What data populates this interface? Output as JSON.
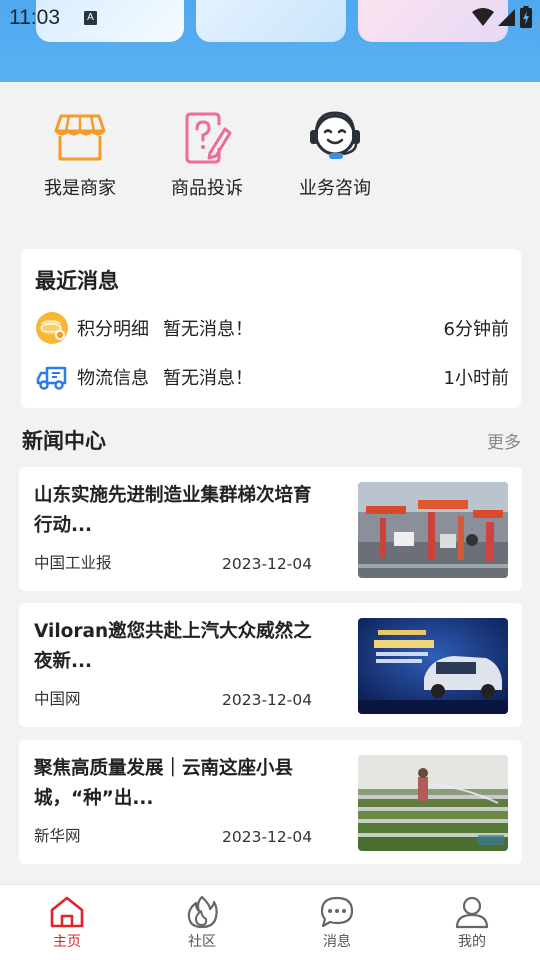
{
  "status_bar": {
    "time": "11:03",
    "notif_icon_letter": "A"
  },
  "quick_actions": [
    {
      "label": "我是商家",
      "icon": "store-icon",
      "color": "#f39c2a"
    },
    {
      "label": "商品投诉",
      "icon": "complaint-icon",
      "color": "#ee6a9a"
    },
    {
      "label": "业务咨询",
      "icon": "headset-icon",
      "color": "#2a2f3a"
    }
  ],
  "recent": {
    "title": "最近消息",
    "items": [
      {
        "name": "积分明细",
        "text": "暂无消息！",
        "time": "6分钟前",
        "icon": "coins-icon"
      },
      {
        "name": "物流信息",
        "text": "暂无消息！",
        "time": "1小时前",
        "icon": "truck-icon"
      }
    ]
  },
  "news": {
    "title": "新闻中心",
    "more": "更多",
    "items": [
      {
        "title": "山东实施先进制造业集群梯次培育行动...",
        "source": "中国工业报",
        "date": "2023-12-04",
        "image": "factory-robots-photo"
      },
      {
        "title": "Viloran邀您共赴上汽大众威然之夜新...",
        "source": "中国网",
        "date": "2023-12-04",
        "image": "car-poster-photo"
      },
      {
        "title": "聚焦高质量发展｜云南这座小县城，“种”出...",
        "source": "新华网",
        "date": "2023-12-04",
        "image": "greenhouse-photo"
      }
    ]
  },
  "tabbar": {
    "active_color": "#e0232a",
    "tabs": [
      {
        "label": "主页",
        "icon": "home-icon",
        "active": true
      },
      {
        "label": "社区",
        "icon": "flame-icon",
        "active": false
      },
      {
        "label": "消息",
        "icon": "chat-bubble-icon",
        "active": false
      },
      {
        "label": "我的",
        "icon": "user-icon",
        "active": false
      }
    ]
  },
  "colors": {
    "header_blue": "#56aef0",
    "background": "#f2f2f2"
  }
}
